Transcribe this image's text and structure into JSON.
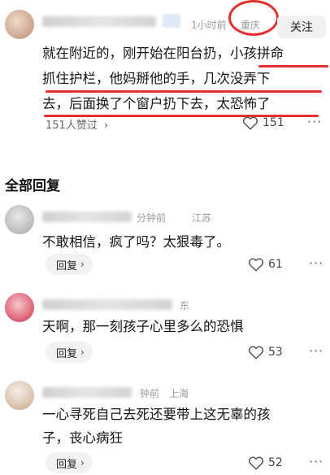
{
  "top_comment": {
    "time": "1小时前",
    "location": "重庆",
    "follow_label": "关注",
    "text_lines": [
      "就在附近的，刚开始在阳台扔，小孩拼命",
      "抓住护栏，他妈掰他的手，几次没弄下",
      "去，后面换了个窗户扔下去，太恐怖了"
    ],
    "upvoted": "151人赞过",
    "like_count": "151"
  },
  "section_title": "全部回复",
  "replies": [
    {
      "time": "分钟前",
      "location": "江苏",
      "text_lines": [
        "不敢相信，疯了吗？太狠毒了。"
      ],
      "reply_label": "回复",
      "like_count": "61"
    },
    {
      "time": "",
      "location": "东",
      "text_lines": [
        "天啊，那一刻孩子心里多么的恐惧"
      ],
      "reply_label": "回复",
      "like_count": "53"
    },
    {
      "time": "钟前",
      "location": "上海",
      "text_lines": [
        "一心寻死自己去死还要带上这无辜的孩",
        "子，丧心病狂"
      ],
      "reply_label": "回复",
      "like_count": "52"
    }
  ],
  "icons": {
    "like": "heart-outline-icon",
    "more": "more-dots-icon",
    "chevron": "chevron-right-icon"
  },
  "colors": {
    "annotation_red": "#e3312d",
    "muted_text": "#9a9a9a",
    "pill_bg": "#f2f2f2"
  }
}
